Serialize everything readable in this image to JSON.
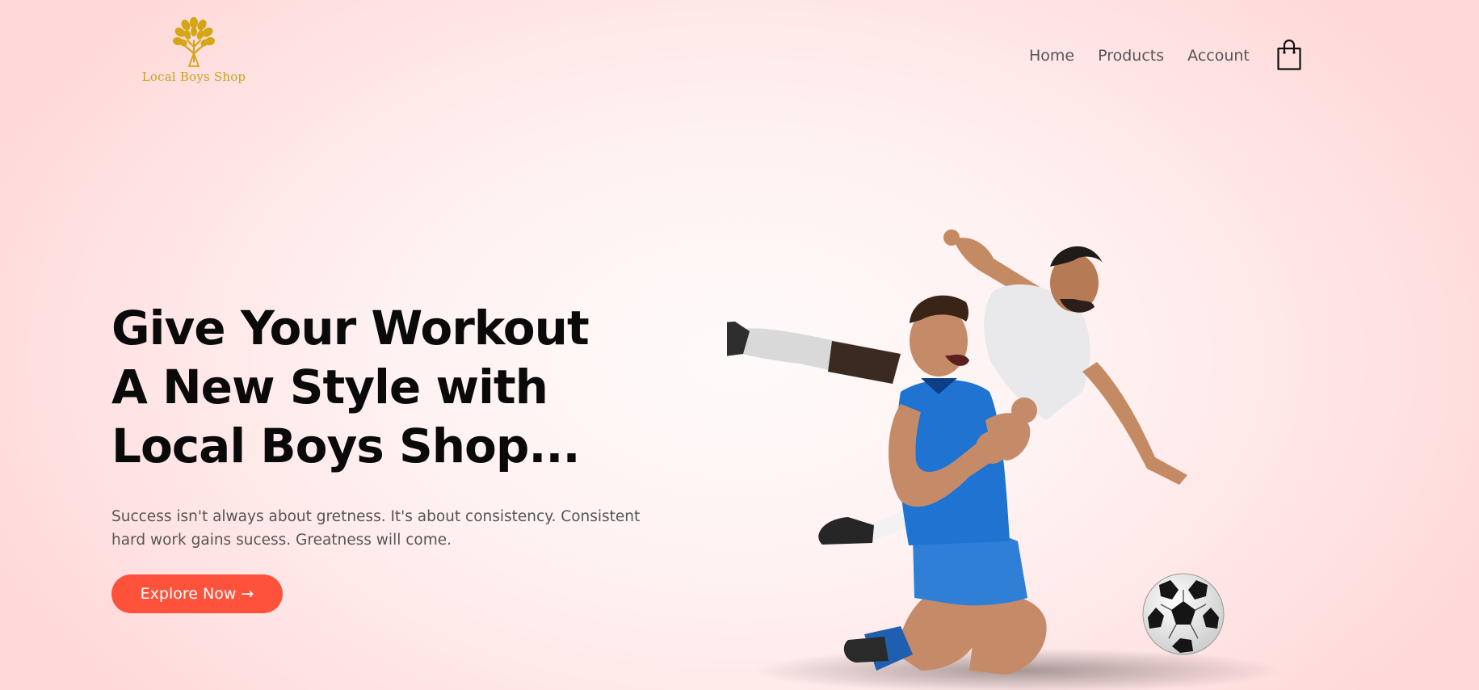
{
  "brand": {
    "name": "Local Boys Shop",
    "logo_icon": "tree-icon",
    "logo_color": "#c9a21a"
  },
  "nav": {
    "items": [
      {
        "label": "Home"
      },
      {
        "label": "Products"
      },
      {
        "label": "Account"
      }
    ],
    "cart_icon": "shopping-bag-icon"
  },
  "hero": {
    "title_lines": [
      "Give Your Workout",
      "A New Style with",
      "Local Boys Shop..."
    ],
    "subtitle": "Success isn't always about gretness. It's about consistency. Consistent hard work gains sucess. Greatness will come.",
    "cta_label": "Explore Now →",
    "cta_color": "#ff523b",
    "image_subject": "two soccer players celebrating with a soccer ball"
  },
  "colors": {
    "background": "#ffe2e2",
    "accent": "#ff523b",
    "text": "#0a0a0a"
  }
}
